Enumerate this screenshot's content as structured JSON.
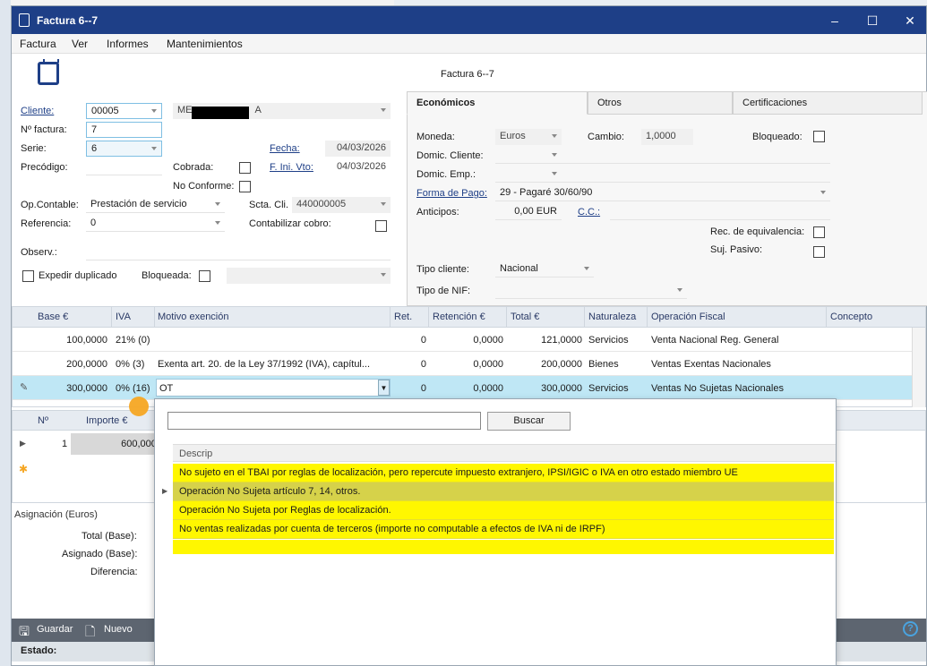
{
  "window": {
    "title": "Factura 6--7",
    "header_title": "Factura 6--7"
  },
  "menu": [
    "Factura",
    "Ver",
    "Informes",
    "Mantenimientos"
  ],
  "form": {
    "cliente_label": "Cliente:",
    "cliente_code": "00005",
    "cliente_name_prefix": "ME",
    "cliente_name_suffix": "A",
    "nfactura_label": "Nº factura:",
    "nfactura": "7",
    "serie_label": "Serie:",
    "serie": "6",
    "fecha_label": "Fecha:",
    "fecha": "04/03/2026",
    "precodigo_label": "Precódigo:",
    "cobrada_label": "Cobrada:",
    "fini_label": "F. Ini. Vto:",
    "fini": "04/03/2026",
    "noconforme_label": "No Conforme:",
    "opcontable_label": "Op.Contable:",
    "opcontable": "Prestación de servicio",
    "sctacli_label": "Scta. Cli.",
    "sctacli": "440000005",
    "referencia_label": "Referencia:",
    "referencia": "0",
    "contabilizar_label": "Contabilizar cobro:",
    "observ_label": "Observ.:",
    "expedir_label": "Expedir duplicado",
    "bloqueada_label": "Bloqueada:"
  },
  "tabs": [
    "Económicos",
    "Otros",
    "Certificaciones"
  ],
  "economicos": {
    "moneda_label": "Moneda:",
    "moneda": "Euros",
    "cambio_label": "Cambio:",
    "cambio": "1,0000",
    "bloqueado_label": "Bloqueado:",
    "domcliente_label": "Domic. Cliente:",
    "domemp_label": "Domic. Emp.:",
    "formapago_label": "Forma de Pago:",
    "formapago": "29 - Pagaré 30/60/90",
    "anticipos_label": "Anticipos:",
    "anticipos": "0,00 EUR",
    "cc_label": "C.C.:",
    "receq_label": "Rec. de equivalencia:",
    "sujpasivo_label": "Suj. Pasivo:",
    "tipocliente_label": "Tipo cliente:",
    "tipocliente": "Nacional",
    "tiponif_label": "Tipo de NIF:"
  },
  "lines_grid": {
    "columns": [
      "Base €",
      "IVA",
      "Motivo exención",
      "Ret.",
      "Retención €",
      "Total €",
      "Naturaleza",
      "Operación Fiscal",
      "Concepto"
    ],
    "rows": [
      {
        "base": "100,0000",
        "iva": "21% (0)",
        "motivo": "",
        "ret": "0",
        "retencion": "0,0000",
        "total": "121,0000",
        "naturaleza": "Servicios",
        "operacion": "Venta Nacional Reg. General"
      },
      {
        "base": "200,0000",
        "iva": "0% (3)",
        "motivo": "Exenta art. 20. de la Ley 37/1992 (IVA),  capítul...",
        "ret": "0",
        "retencion": "0,0000",
        "total": "200,0000",
        "naturaleza": "Bienes",
        "operacion": "Ventas Exentas Nacionales"
      },
      {
        "base": "300,0000",
        "iva": "0% (16)",
        "motivo": "OT",
        "ret": "0",
        "retencion": "0,0000",
        "total": "300,0000",
        "naturaleza": "Servicios",
        "operacion": "Ventas No Sujetas Nacionales"
      }
    ]
  },
  "vencimientos": {
    "col_n": "Nº",
    "col_importe": "Importe €",
    "row_n": "1",
    "row_importe": "600,0000"
  },
  "asignacion": {
    "title": "Asignación (Euros)",
    "total_label": "Total (Base):",
    "asignado_label": "Asignado (Base):",
    "diferencia_label": "Diferencia:"
  },
  "toolbar": {
    "guardar": "Guardar",
    "nuevo": "Nuevo"
  },
  "status": {
    "estado_label": "Estado:"
  },
  "popup": {
    "buscar": "Buscar",
    "column": "Descrip",
    "items": [
      "No sujeto en el TBAI por reglas de localización, pero repercute impuesto extranjero, IPSI/IGIC o IVA en otro estado miembro UE",
      "Operación No Sujeta artículo 7, 14, otros.",
      "Operación No Sujeta por Reglas de localización.",
      "No ventas realizadas por cuenta de terceros (importe no computable a efectos de IVA ni de IRPF)"
    ]
  },
  "colors": {
    "title_bar": "#1e3f87",
    "selected_row": "#bfe7f5",
    "popup_highlight": "#fff700",
    "accent": "#f5a623"
  }
}
